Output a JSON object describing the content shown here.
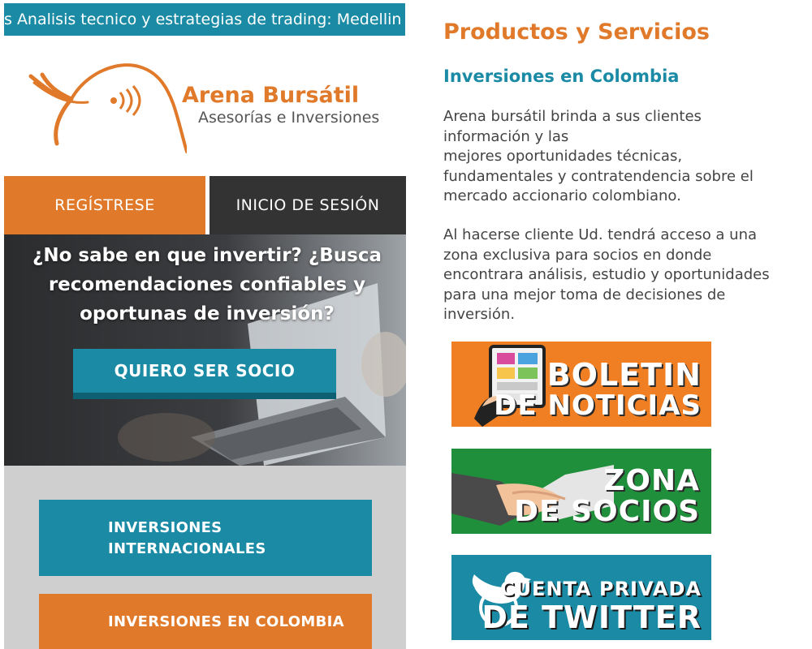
{
  "ticker": {
    "text": "s Analisis tecnico y estrategias de trading: Medellin"
  },
  "brand": {
    "name": "Arena Bursátil",
    "tagline": "Asesorías e Inversiones"
  },
  "nav": {
    "register": "REGÍSTRESE",
    "login": "INICIO DE SESIÓN"
  },
  "hero": {
    "line1": "¿No sabe en que invertir? ¿Busca",
    "line2": "recomendaciones confiables y",
    "line3": "oportunas de inversión?",
    "cta": "QUIERO SER SOCIO"
  },
  "links": {
    "intl_line1": "INVERSIONES",
    "intl_line2": "INTERNACIONALES",
    "colombia": "INVERSIONES EN COLOMBIA"
  },
  "products": {
    "title": "Productos y Servicios",
    "subtitle": "Inversiones en Colombia",
    "p1": [
      "Arena bursátil  brinda a sus clientes",
      "información y las",
      "mejores oportunidades técnicas,",
      "fundamentales y contratendencia sobre el",
      "mercado accionario colombiano."
    ],
    "p2": [
      "Al hacerse cliente Ud. tendrá acceso a una",
      "zona exclusiva para socios en donde",
      "encontrara análisis, estudio y oportunidades",
      "para una mejor toma de decisiones de",
      "inversión."
    ]
  },
  "banners": {
    "boletin_1": "BOLETIN",
    "boletin_2": "DE NOTICIAS",
    "zona_1": "ZONA",
    "zona_2": "DE SOCIOS",
    "twitter_1": "CUENTA PRIVADA",
    "twitter_2": "DE TWITTER"
  },
  "colors": {
    "orange": "#e07a2a",
    "teal": "#1a8aa5",
    "dark": "#333333",
    "green": "#1f8f3c"
  }
}
